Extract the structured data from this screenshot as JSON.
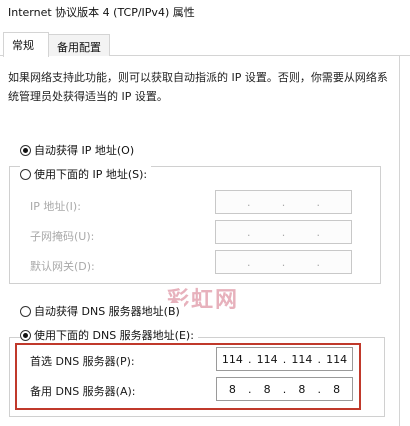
{
  "window": {
    "title": "Internet 协议版本 4 (TCP/IPv4) 属性"
  },
  "tabs": [
    {
      "label": "常规",
      "active": true
    },
    {
      "label": "备用配置",
      "active": false
    }
  ],
  "description": "如果网络支持此功能，则可以获取自动指派的 IP 设置。否则，你需要从网络系统管理员处获得适当的 IP 设置。",
  "ip": {
    "auto_label": "自动获得 IP 地址(O)",
    "auto_selected": true,
    "manual_label": "使用下面的 IP 地址(S):",
    "fields": [
      {
        "label": "IP 地址(I):",
        "octets": [
          "",
          "",
          "",
          ""
        ]
      },
      {
        "label": "子网掩码(U):",
        "octets": [
          "",
          "",
          "",
          ""
        ]
      },
      {
        "label": "默认网关(D):",
        "octets": [
          "",
          "",
          "",
          ""
        ]
      }
    ]
  },
  "dns": {
    "auto_label": "自动获得 DNS 服务器地址(B)",
    "manual_label": "使用下面的 DNS 服务器地址(E):",
    "manual_selected": true,
    "preferred": {
      "label": "首选 DNS 服务器(P):",
      "octets": [
        "114",
        "114",
        "114",
        "114"
      ]
    },
    "alternate": {
      "label": "备用 DNS 服务器(A):",
      "octets": [
        "8",
        "8",
        "8",
        "8"
      ]
    }
  },
  "watermark": "彩虹网",
  "colors": {
    "highlight": "#c0392b",
    "disabled_text": "#a9a9a9",
    "watermark": "#e7b1bc"
  }
}
